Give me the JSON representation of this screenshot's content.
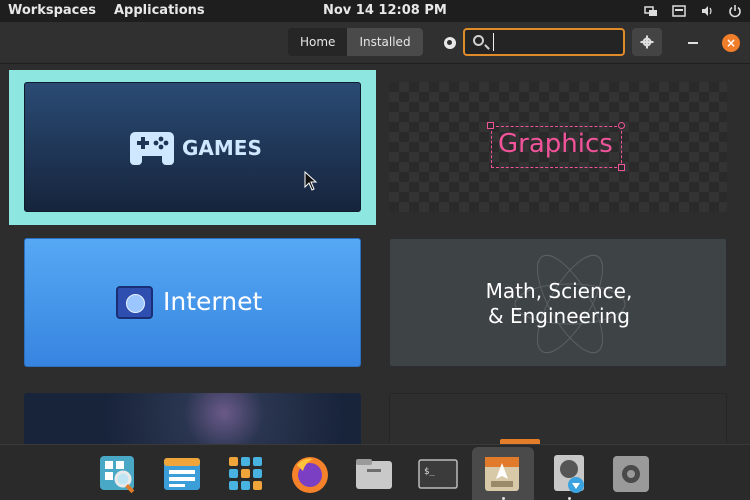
{
  "topbar": {
    "workspaces": "Workspaces",
    "applications": "Applications",
    "datetime": "Nov 14  12:08 PM"
  },
  "header": {
    "tab_home": "Home",
    "tab_installed": "Installed",
    "search_value": "",
    "close_glyph": "×"
  },
  "categories": {
    "games": "GAMES",
    "graphics": "Graphics",
    "internet": "Internet",
    "math_line1": "Math, Science,",
    "math_line2": "& Engineering"
  },
  "colors": {
    "accent": "#f07d2a",
    "selection": "#8de6e0",
    "graphics_pink": "#f0539a"
  },
  "dock": {
    "apps": [
      "search-app-icon",
      "files-window-icon",
      "app-grid-icon",
      "firefox-icon",
      "file-manager-icon",
      "terminal-icon",
      "app-center-icon",
      "installer-icon",
      "settings-icon"
    ]
  }
}
